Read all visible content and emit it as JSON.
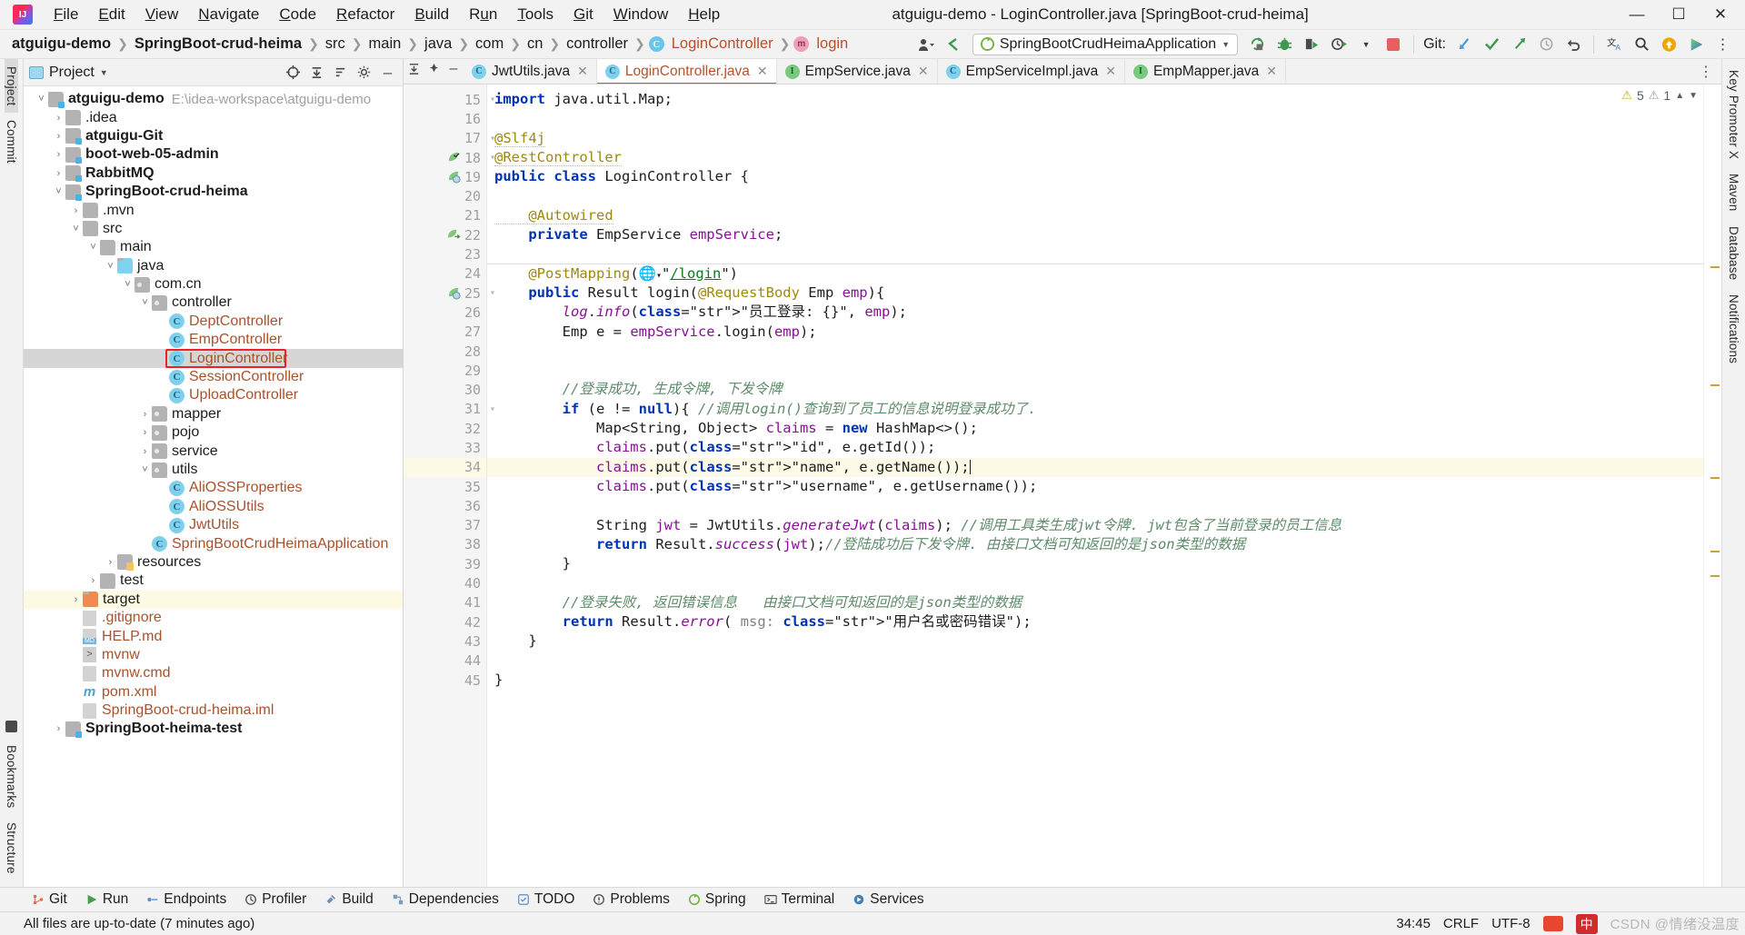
{
  "titlebar": {
    "window_title": "atguigu-demo - LoginController.java [SpringBoot-crud-heima]",
    "logo": "intellij-idea-logo",
    "menus": [
      "File",
      "Edit",
      "View",
      "Navigate",
      "Code",
      "Refactor",
      "Build",
      "Run",
      "Tools",
      "Git",
      "Window",
      "Help"
    ],
    "window_buttons": {
      "minimize": "—",
      "maximize": "❐",
      "close": "✕"
    }
  },
  "navbar": {
    "breadcrumbs": [
      {
        "label": "atguigu-demo",
        "style": "bold"
      },
      {
        "label": "SpringBoot-crud-heima",
        "style": "bold"
      },
      {
        "label": "src",
        "style": "plain"
      },
      {
        "label": "main",
        "style": "plain"
      },
      {
        "label": "java",
        "style": "plain"
      },
      {
        "label": "com",
        "style": "plain"
      },
      {
        "label": "cn",
        "style": "plain"
      },
      {
        "label": "controller",
        "style": "plain"
      },
      {
        "label": "LoginController",
        "style": "class",
        "badge": "C"
      },
      {
        "label": "login",
        "style": "method",
        "badge": "m"
      }
    ],
    "run_config": "SpringBootCrudHeimaApplication",
    "git_label": "Git:",
    "icons": [
      "person-icon",
      "back-arrow-icon",
      "run-icon",
      "debug-icon",
      "coverage-icon",
      "profile-icon",
      "stop-icon",
      "git-update-icon",
      "git-commit-icon",
      "git-push-icon",
      "history-icon",
      "rollback-icon",
      "translate-icon",
      "search-icon",
      "upload-icon",
      "play-colored-icon",
      "more-icon"
    ]
  },
  "left_rail": {
    "tabs": [
      "Project",
      "Commit"
    ],
    "bottom_tabs": [
      "Bookmarks",
      "Structure"
    ]
  },
  "right_rail": {
    "tabs": [
      "Key Promoter X",
      "Maven",
      "Database",
      "Notifications"
    ]
  },
  "project_panel": {
    "title": "Project",
    "toolbar_icons": [
      "target-icon",
      "collapse-icon",
      "sort-icon",
      "settings-icon",
      "hide-icon",
      "more-icon"
    ],
    "tree": [
      {
        "indent": 0,
        "arrow": "v",
        "icon": "folder-module",
        "label": "atguigu-demo",
        "bold": true,
        "path": "E:\\idea-workspace\\atguigu-demo"
      },
      {
        "indent": 1,
        "arrow": ">",
        "icon": "folder",
        "label": ".idea",
        "bold": false
      },
      {
        "indent": 1,
        "arrow": ">",
        "icon": "folder-module",
        "label": "atguigu-Git",
        "bold": true
      },
      {
        "indent": 1,
        "arrow": ">",
        "icon": "folder-module",
        "label": "boot-web-05-admin",
        "bold": true
      },
      {
        "indent": 1,
        "arrow": ">",
        "icon": "folder-module",
        "label": "RabbitMQ",
        "bold": true
      },
      {
        "indent": 1,
        "arrow": "v",
        "icon": "folder-module",
        "label": "SpringBoot-crud-heima",
        "bold": true
      },
      {
        "indent": 2,
        "arrow": ">",
        "icon": "folder",
        "label": ".mvn",
        "bold": false
      },
      {
        "indent": 2,
        "arrow": "v",
        "icon": "folder",
        "label": "src",
        "bold": false
      },
      {
        "indent": 3,
        "arrow": "v",
        "icon": "folder",
        "label": "main",
        "bold": false
      },
      {
        "indent": 4,
        "arrow": "v",
        "icon": "folder-source",
        "label": "java",
        "bold": false
      },
      {
        "indent": 5,
        "arrow": "v",
        "icon": "folder-package",
        "label": "com.cn",
        "bold": false
      },
      {
        "indent": 6,
        "arrow": "v",
        "icon": "folder-package",
        "label": "controller",
        "bold": false
      },
      {
        "indent": 7,
        "arrow": "",
        "icon": "class",
        "label": "DeptController",
        "bold": false
      },
      {
        "indent": 7,
        "arrow": "",
        "icon": "class",
        "label": "EmpController",
        "bold": false
      },
      {
        "indent": 7,
        "arrow": "",
        "icon": "class",
        "label": "LoginController",
        "bold": false,
        "selected": true,
        "highlight_box": true
      },
      {
        "indent": 7,
        "arrow": "",
        "icon": "class",
        "label": "SessionController",
        "bold": false
      },
      {
        "indent": 7,
        "arrow": "",
        "icon": "class",
        "label": "UploadController",
        "bold": false
      },
      {
        "indent": 6,
        "arrow": ">",
        "icon": "folder-package",
        "label": "mapper",
        "bold": false
      },
      {
        "indent": 6,
        "arrow": ">",
        "icon": "folder-package",
        "label": "pojo",
        "bold": false
      },
      {
        "indent": 6,
        "arrow": ">",
        "icon": "folder-package",
        "label": "service",
        "bold": false
      },
      {
        "indent": 6,
        "arrow": "v",
        "icon": "folder-package",
        "label": "utils",
        "bold": false
      },
      {
        "indent": 7,
        "arrow": "",
        "icon": "class",
        "label": "AliOSSProperties",
        "bold": false
      },
      {
        "indent": 7,
        "arrow": "",
        "icon": "class",
        "label": "AliOSSUtils",
        "bold": false
      },
      {
        "indent": 7,
        "arrow": "",
        "icon": "class",
        "label": "JwtUtils",
        "bold": false
      },
      {
        "indent": 6,
        "arrow": "",
        "icon": "class-spring",
        "label": "SpringBootCrudHeimaApplication",
        "bold": false
      },
      {
        "indent": 4,
        "arrow": ">",
        "icon": "folder-resources",
        "label": "resources",
        "bold": false
      },
      {
        "indent": 3,
        "arrow": ">",
        "icon": "folder",
        "label": "test",
        "bold": false
      },
      {
        "indent": 2,
        "arrow": ">",
        "icon": "folder-target",
        "label": "target",
        "bold": false,
        "yellow": true
      },
      {
        "indent": 2,
        "arrow": "",
        "icon": "file-gitignore",
        "label": ".gitignore",
        "bold": false
      },
      {
        "indent": 2,
        "arrow": "",
        "icon": "file-md",
        "label": "HELP.md",
        "bold": false
      },
      {
        "indent": 2,
        "arrow": "",
        "icon": "file-sh",
        "label": "mvnw",
        "bold": false
      },
      {
        "indent": 2,
        "arrow": "",
        "icon": "file",
        "label": "mvnw.cmd",
        "bold": false
      },
      {
        "indent": 2,
        "arrow": "",
        "icon": "file-maven",
        "label": "pom.xml",
        "bold": false
      },
      {
        "indent": 2,
        "arrow": "",
        "icon": "file-iml",
        "label": "SpringBoot-crud-heima.iml",
        "bold": false
      },
      {
        "indent": 1,
        "arrow": ">",
        "icon": "folder-module",
        "label": "SpringBoot-heima-test",
        "bold": true
      }
    ]
  },
  "editor": {
    "tabs": [
      {
        "label": "JwtUtils.java",
        "icon": "class",
        "active": false
      },
      {
        "label": "LoginController.java",
        "icon": "class",
        "active": true
      },
      {
        "label": "EmpService.java",
        "icon": "interface",
        "active": false
      },
      {
        "label": "EmpServiceImpl.java",
        "icon": "class",
        "active": false
      },
      {
        "label": "EmpMapper.java",
        "icon": "interface",
        "active": false
      }
    ],
    "inspection": {
      "warnings": "5",
      "weak_warnings": "1"
    },
    "lines": [
      {
        "n": 15,
        "text": "import java.util.Map;",
        "fold": true
      },
      {
        "n": 16,
        "text": ""
      },
      {
        "n": 17,
        "text": "@Slf4j",
        "fold": true
      },
      {
        "n": 18,
        "text": "@RestController",
        "gutter": "bean-check",
        "fold": true
      },
      {
        "n": 19,
        "text": "public class LoginController {",
        "gutter": "bean"
      },
      {
        "n": 20,
        "text": ""
      },
      {
        "n": 21,
        "text": "    @Autowired"
      },
      {
        "n": 22,
        "text": "    private EmpService empService;",
        "gutter": "bean-arrow"
      },
      {
        "n": 23,
        "text": ""
      },
      {
        "n": 24,
        "text": "    @PostMapping(\"/login\")"
      },
      {
        "n": 25,
        "text": "    public Result login(@RequestBody Emp emp){",
        "gutter": "bean",
        "fold": true
      },
      {
        "n": 26,
        "text": "        log.info(\"员工登录: {}\", emp);"
      },
      {
        "n": 27,
        "text": "        Emp e = empService.login(emp);"
      },
      {
        "n": 28,
        "text": ""
      },
      {
        "n": 29,
        "text": ""
      },
      {
        "n": 30,
        "text": "        //登录成功, 生成令牌, 下发令牌"
      },
      {
        "n": 31,
        "text": "        if (e != null){ //调用login()查询到了员工的信息说明登录成功了.",
        "fold": true
      },
      {
        "n": 32,
        "text": "            Map<String, Object> claims = new HashMap<>();"
      },
      {
        "n": 33,
        "text": "            claims.put(\"id\", e.getId());"
      },
      {
        "n": 34,
        "text": "            claims.put(\"name\", e.getName());",
        "current": true
      },
      {
        "n": 35,
        "text": "            claims.put(\"username\", e.getUsername());"
      },
      {
        "n": 36,
        "text": ""
      },
      {
        "n": 37,
        "text": "            String jwt = JwtUtils.generateJwt(claims); //调用工具类生成jwt令牌. jwt包含了当前登录的员工信息"
      },
      {
        "n": 38,
        "text": "            return Result.success(jwt);//登陆成功后下发令牌. 由接口文档可知返回的是json类型的数据"
      },
      {
        "n": 39,
        "text": "        }"
      },
      {
        "n": 40,
        "text": ""
      },
      {
        "n": 41,
        "text": "        //登录失败, 返回错误信息   由接口文档可知返回的是json类型的数据"
      },
      {
        "n": 42,
        "text": "        return Result.error( msg: \"用户名或密码错误\");"
      },
      {
        "n": 43,
        "text": "    }"
      },
      {
        "n": 44,
        "text": ""
      },
      {
        "n": 45,
        "text": "}"
      }
    ]
  },
  "tool_windows": [
    {
      "label": "Git",
      "icon": "git-icon"
    },
    {
      "label": "Run",
      "icon": "run-icon"
    },
    {
      "label": "Endpoints",
      "icon": "endpoints-icon"
    },
    {
      "label": "Profiler",
      "icon": "profiler-icon"
    },
    {
      "label": "Build",
      "icon": "build-icon"
    },
    {
      "label": "Dependencies",
      "icon": "dependencies-icon"
    },
    {
      "label": "TODO",
      "icon": "todo-icon"
    },
    {
      "label": "Problems",
      "icon": "problems-icon"
    },
    {
      "label": "Spring",
      "icon": "spring-icon"
    },
    {
      "label": "Terminal",
      "icon": "terminal-icon"
    },
    {
      "label": "Services",
      "icon": "services-icon"
    }
  ],
  "status_bar": {
    "message": "All files are up-to-date (7 minutes ago)",
    "caret_position": "34:45",
    "line_separator": "CRLF",
    "encoding": "UTF-8",
    "ime_label": "中",
    "watermark": "CSDN @情绪没温度"
  },
  "colors": {
    "accent_blue": "#4083c9",
    "class_orange": "#a8522c",
    "keyword_blue": "#0033b3",
    "string_green": "#067d17",
    "annotation_gold": "#9e880d",
    "field_purple": "#871094",
    "comment_green": "#5d8a6a",
    "highlight_red": "#ee2222"
  }
}
